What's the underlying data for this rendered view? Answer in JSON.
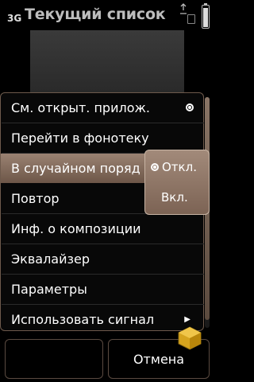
{
  "status": {
    "network": "3G",
    "title": "Текущий список"
  },
  "menu": {
    "items": [
      {
        "label": "См. открыт. прилож."
      },
      {
        "label": "Перейти в фонотеку"
      },
      {
        "label": "В случайном поряд"
      },
      {
        "label": "Повтор"
      },
      {
        "label": "Инф. о композиции"
      },
      {
        "label": "Эквалайзер"
      },
      {
        "label": "Параметры"
      },
      {
        "label": "Использовать сигнал"
      }
    ]
  },
  "submenu": {
    "options": [
      {
        "label": "Откл.",
        "selected": true
      },
      {
        "label": "Вкл.",
        "selected": false
      }
    ]
  },
  "softkeys": {
    "left_label": "",
    "right_label": "Отмена"
  },
  "colors": {
    "highlight": "#8a7262",
    "border": "#6e5a4c"
  }
}
